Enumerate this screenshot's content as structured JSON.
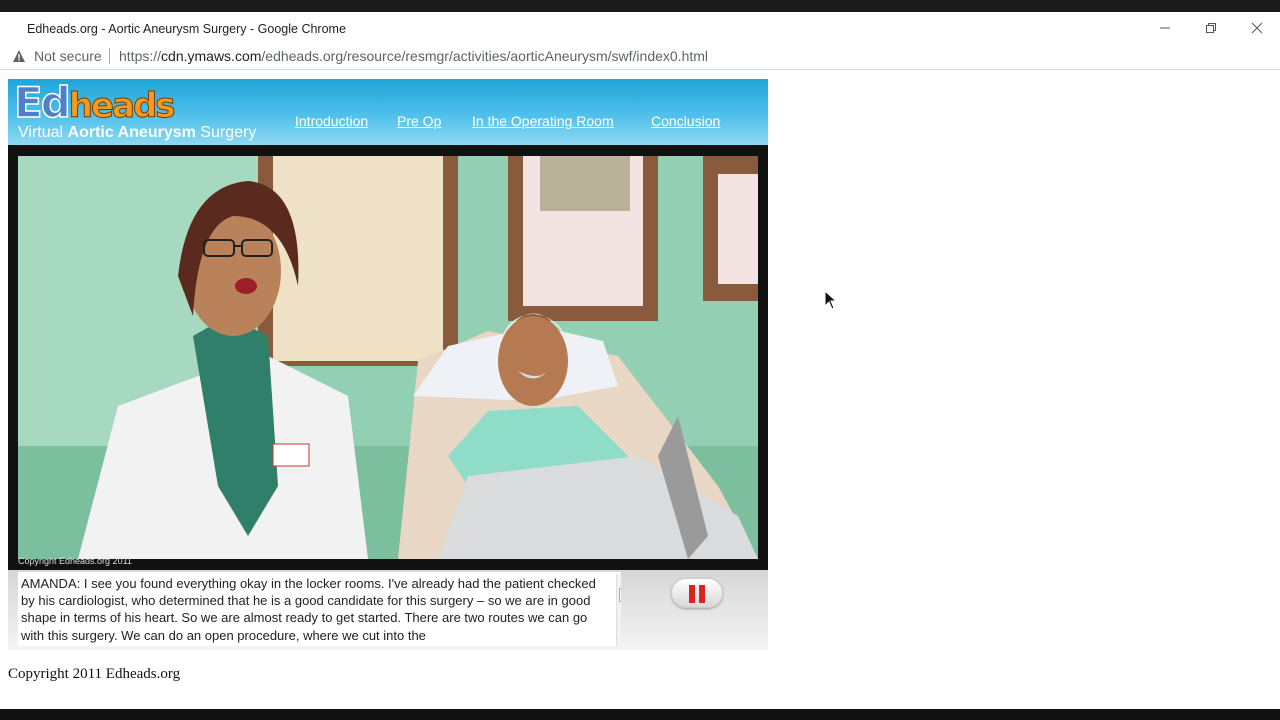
{
  "window": {
    "title": "Edheads.org - Aortic Aneurysm Surgery - Google Chrome",
    "minimize_icon": "minimize-icon",
    "restore_icon": "restore-icon",
    "close_icon": "close-icon"
  },
  "addressbar": {
    "security_label": "Not secure",
    "url_prefix": "https://",
    "url_domain": "cdn.ymaws.com",
    "url_path": "/edheads.org/resource/resmgr/activities/aorticAneurysm/swf/index0.html"
  },
  "header": {
    "logo_part1": "Ed",
    "logo_part2": "heads",
    "subtitle_pre": "Virtual ",
    "subtitle_bold": "Aortic Aneurysm",
    "subtitle_post": " Surgery",
    "nav": [
      "Introduction",
      "Pre Op",
      "In the Operating Room",
      "Conclusion"
    ]
  },
  "stage": {
    "copyright": "Copyright Edheads.org 2011"
  },
  "caption": {
    "text": "AMANDA: I see you found everything okay in the locker rooms. I've already had the patient checked by his cardiologist, who determined that he is a good candidate for this surgery – so we are in good shape in terms of his heart. So we are almost ready to get started. There are two routes we can go with this surgery. We can do an open procedure, where we cut into the"
  },
  "footer": {
    "copyright": "Copyright 2011 Edheads.org"
  },
  "colors": {
    "header_top": "#1fa5d8",
    "header_bottom": "#8fd8f2",
    "pause_red": "#dd2222"
  }
}
